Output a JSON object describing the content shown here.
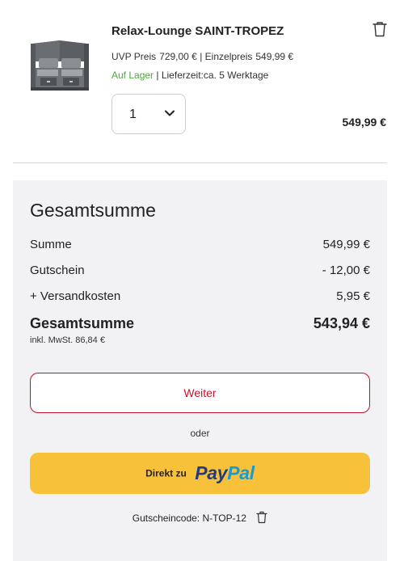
{
  "cart_item": {
    "title": "Relax-Lounge SAINT-TROPEZ",
    "uvp_label": "UVP Preis",
    "uvp_value": "729,00 €",
    "separator": "|",
    "unit_label": "Einzelpreis",
    "unit_value": "549,99 €",
    "stock_status": "Auf Lager",
    "delivery_label": "| Lieferzeit:",
    "delivery_value": "ca. 5 Werktage",
    "quantity": "1",
    "line_total": "549,99 €",
    "image_icon": "lounge-product-image",
    "delete_icon": "trash-icon"
  },
  "summary": {
    "heading": "Gesamtsumme",
    "rows": [
      {
        "label": "Summe",
        "value": "549,99 €"
      },
      {
        "label": "Gutschein",
        "value": "- 12,00 €"
      },
      {
        "label": "+ Versandkosten",
        "value": "5,95 €"
      }
    ],
    "total_label": "Gesamtsumme",
    "total_value": "543,94 €",
    "vat_note": "inkl. MwSt. 86,84 €",
    "continue_label": "Weiter",
    "or_label": "oder",
    "paypal_prefix": "Direkt zu",
    "paypal_logo_pay": "Pay",
    "paypal_logo_pal": "Pal",
    "coupon_text": "Gutscheincode: N-TOP-12"
  },
  "colors": {
    "accent": "#c8102e",
    "in_stock": "#4aa83a",
    "paypal_button": "#f7c23a",
    "paypal_dark": "#253b80",
    "paypal_light": "#179bd7",
    "panel_bg": "#f2f2f4"
  }
}
